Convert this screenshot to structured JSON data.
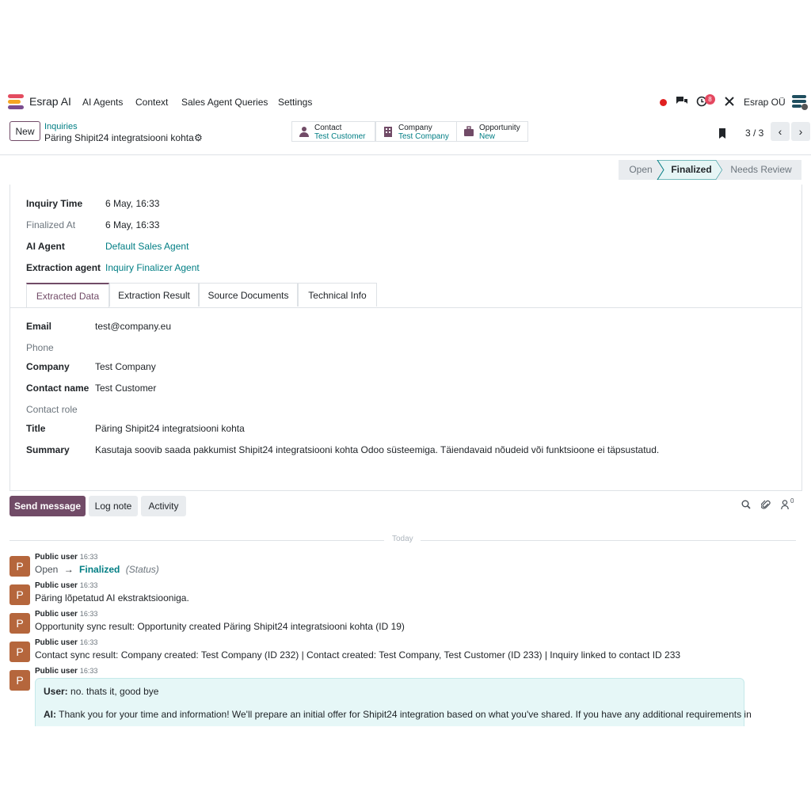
{
  "nav": {
    "brand": "Esrap AI",
    "menu": [
      "AI Agents",
      "Context",
      "Sales Agent Queries",
      "Settings"
    ],
    "activity_badge": "8",
    "company": "Esrap OÜ"
  },
  "control": {
    "new_label": "New",
    "breadcrumb_parent": "Inquiries",
    "breadcrumb_current": "Päring Shipit24 integratsiooni kohta",
    "smart_buttons": [
      {
        "title": "Contact",
        "value": "Test Customer",
        "icon": "person-icon"
      },
      {
        "title": "Company",
        "value": "Test Company",
        "icon": "building-icon"
      },
      {
        "title": "Opportunity",
        "value": "New",
        "icon": "briefcase-icon"
      }
    ],
    "pager": "3 / 3"
  },
  "status": {
    "stages": [
      "Open",
      "Finalized",
      "Needs Review"
    ],
    "current": "Finalized"
  },
  "form": {
    "header_fields": [
      {
        "label": "Inquiry Time",
        "value": "6 May, 16:33"
      },
      {
        "label": "Finalized At",
        "value": "6 May, 16:33"
      },
      {
        "label": "AI Agent",
        "value": "Default Sales Agent"
      },
      {
        "label": "Extraction agent",
        "value": "Inquiry Finalizer Agent"
      }
    ],
    "tabs": [
      "Extracted Data",
      "Extraction Result",
      "Source Documents",
      "Technical Info"
    ],
    "extracted": [
      {
        "label": "Email",
        "value": "test@company.eu"
      },
      {
        "label": "Phone",
        "value": ""
      },
      {
        "label": "Company",
        "value": "Test Company"
      },
      {
        "label": "Contact name",
        "value": "Test Customer"
      },
      {
        "label": "Contact role",
        "value": ""
      },
      {
        "label": "Title",
        "value": "Päring Shipit24 integratsiooni kohta"
      },
      {
        "label": "Summary",
        "value": "Kasutaja soovib saada pakkumist Shipit24 integratsiooni kohta Odoo süsteemiga. Täiendavaid nõudeid või funktsioone ei täpsustatud."
      }
    ]
  },
  "chatter": {
    "send_message": "Send message",
    "log_note": "Log note",
    "activity": "Activity",
    "followers": "0",
    "today": "Today",
    "messages": [
      {
        "avatar": "P",
        "author": "Public user",
        "time": "16:33",
        "from": "Open",
        "arrow": "→",
        "to": "Finalized",
        "field": "(Status)"
      },
      {
        "avatar": "P",
        "author": "Public user",
        "time": "16:33",
        "body": "Päring lõpetatud AI ekstraktsiooniga."
      },
      {
        "avatar": "P",
        "author": "Public user",
        "time": "16:33",
        "body": "Opportunity sync result: Opportunity created Päring Shipit24 integratsiooni kohta (ID 19)"
      },
      {
        "avatar": "P",
        "author": "Public user",
        "time": "16:33",
        "body": "Contact sync result: Company created: Test Company (ID 232) | Contact created: Test Company, Test Customer (ID 233) | Inquiry linked to contact ID 233"
      },
      {
        "avatar": "P",
        "author": "Public user",
        "time": "16:33",
        "user_label": "User:",
        "user_text": " no. thats it, good bye",
        "ai_label": "AI:",
        "ai_text": " Thank you for your time and information! We'll prepare an initial offer for Shipit24 integration based on what you've shared. If you have any additional requirements in"
      }
    ]
  }
}
